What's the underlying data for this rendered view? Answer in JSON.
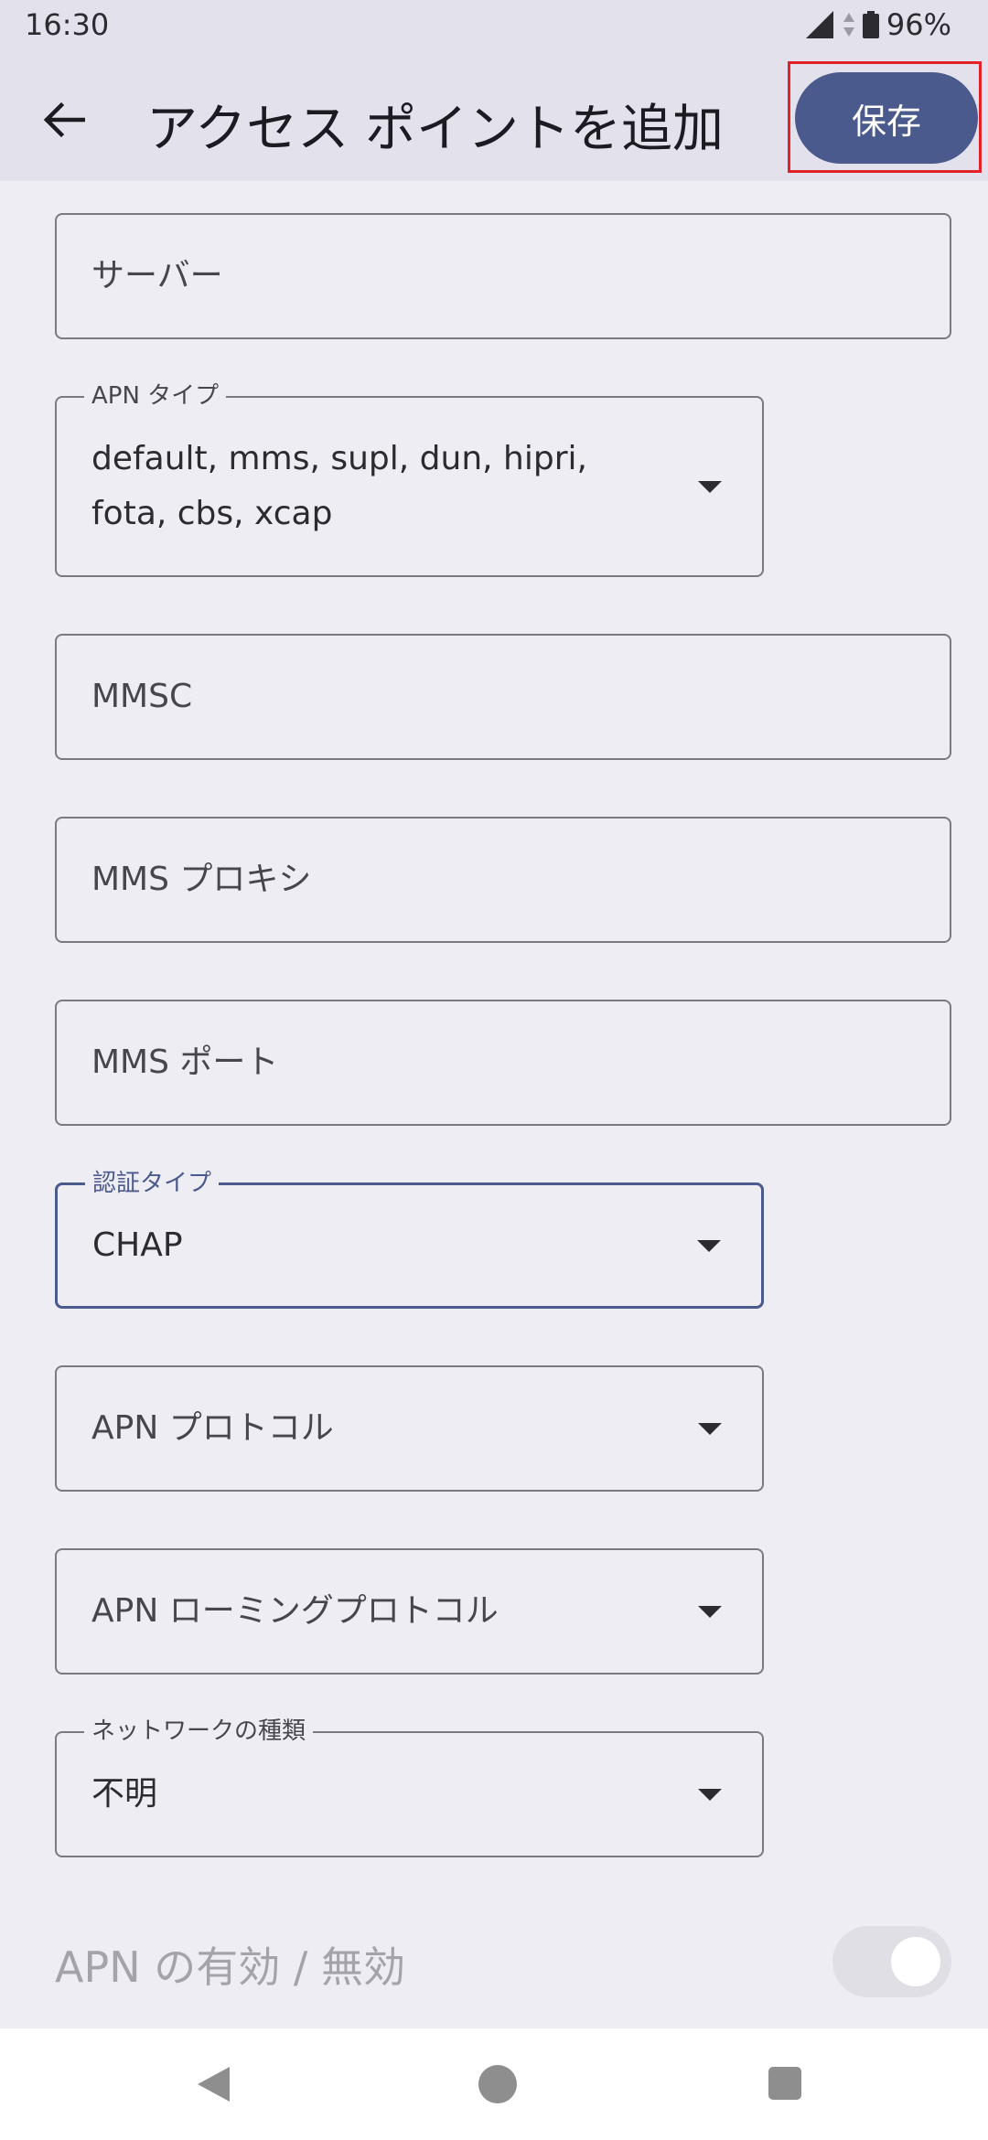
{
  "status_bar": {
    "time": "16:30",
    "battery_percent": "96%",
    "icons": [
      "signal-icon",
      "data-arrows-icon",
      "battery-icon"
    ]
  },
  "app_bar": {
    "back_icon": "arrow-left-icon",
    "title": "アクセス ポイントを追加",
    "save_label": "保存",
    "save_color": "#4a5a8c"
  },
  "fields": {
    "server": {
      "placeholder": "サーバー"
    },
    "apn_type": {
      "label": "APN タイプ",
      "value_line1": "default, mms, supl, dun, hipri,",
      "value_line2": "fota, cbs, xcap"
    },
    "mmsc": {
      "placeholder": "MMSC"
    },
    "mms_proxy": {
      "placeholder": "MMS プロキシ"
    },
    "mms_port": {
      "placeholder": "MMS ポート"
    },
    "auth_type": {
      "label": "認証タイプ",
      "value": "CHAP"
    },
    "apn_protocol": {
      "placeholder": "APN プロトコル"
    },
    "apn_roaming_protocol": {
      "placeholder": "APN ローミングプロトコル"
    },
    "network_type": {
      "label": "ネットワークの種類",
      "value": "不明"
    }
  },
  "apn_toggle": {
    "label": "APN の有効 / 無効",
    "enabled": false
  },
  "nav_bar": {
    "icons": [
      "nav-back-icon",
      "nav-home-icon",
      "nav-recents-icon"
    ]
  },
  "colors": {
    "accent": "#4a5a8c",
    "background": "#efedf4",
    "app_bar": "#e3e2ec",
    "highlight": "#e32228"
  }
}
